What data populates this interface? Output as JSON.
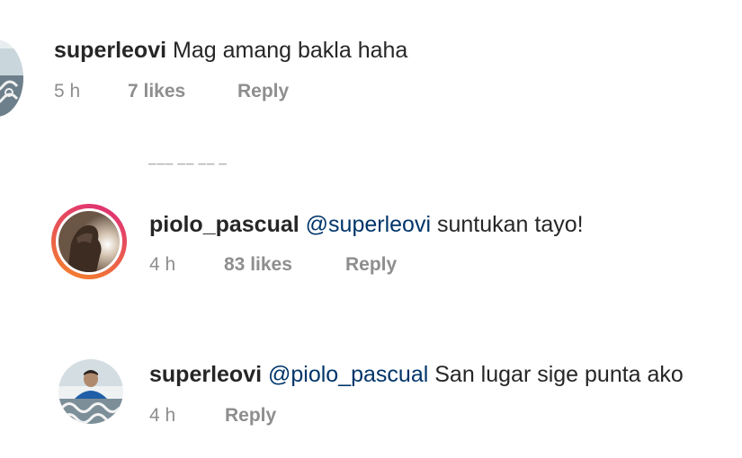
{
  "comments": [
    {
      "username": "superleovi",
      "mention": "",
      "text": "Mag amang bakla haha",
      "time": "5 h",
      "likes": "7 likes",
      "reply": "Reply"
    },
    {
      "username": "piolo_pascual",
      "mention": "@superleovi",
      "text": "suntukan tayo!",
      "time": "4 h",
      "likes": "83 likes",
      "reply": "Reply"
    },
    {
      "username": "superleovi",
      "mention": "@piolo_pascual",
      "text": "San lugar sige punta ako",
      "time": "4 h",
      "likes": "",
      "reply": "Reply"
    }
  ],
  "colors": {
    "username": "#262626",
    "mention": "#003569",
    "meta": "#8e8e8e",
    "story_ring_start": "#f58529",
    "story_ring_end": "#dd2a7b"
  }
}
